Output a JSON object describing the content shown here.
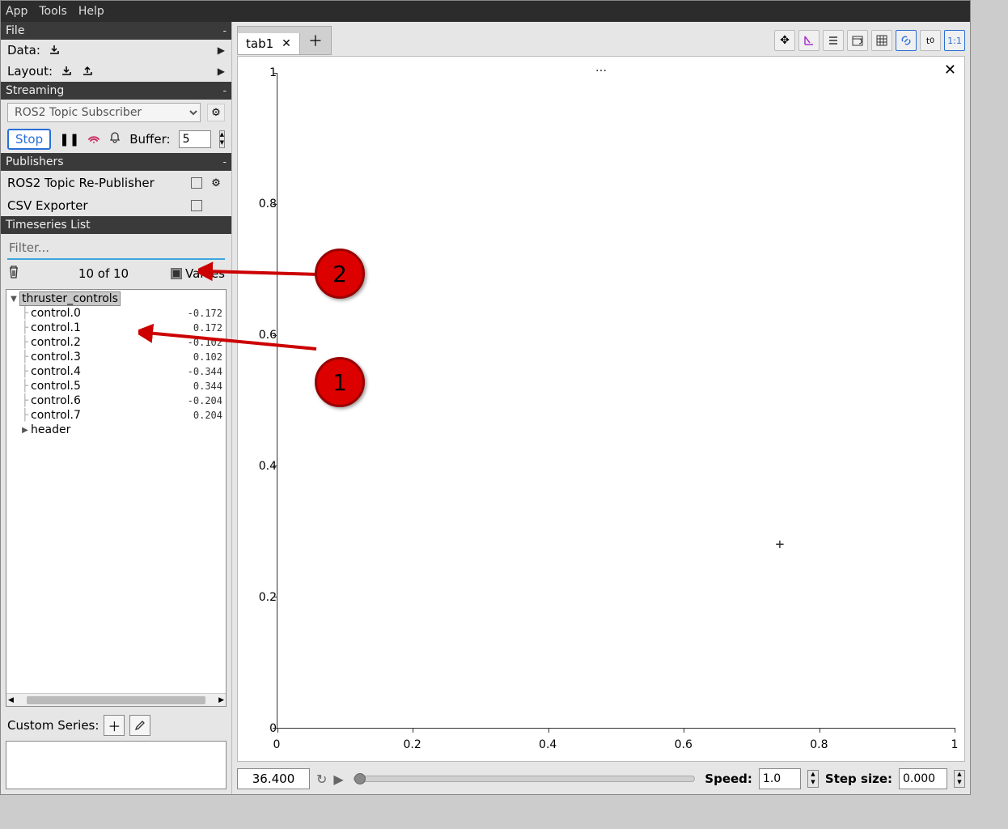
{
  "menu": {
    "app": "App",
    "tools": "Tools",
    "help": "Help"
  },
  "sections": {
    "file": "File",
    "data_label": "Data:",
    "layout_label": "Layout:",
    "streaming": "Streaming",
    "publishers": "Publishers",
    "timeseries": "Timeseries List",
    "custom_series": "Custom Series:"
  },
  "streaming": {
    "select_value": "ROS2 Topic Subscriber",
    "stop_label": "Stop",
    "buffer_label": "Buffer:",
    "buffer_value": "5"
  },
  "publishers": [
    {
      "name": "ROS2 Topic Re-Publisher",
      "gear": true
    },
    {
      "name": "CSV Exporter",
      "gear": false
    }
  ],
  "filter_placeholder": "Filter...",
  "list_count": "10 of 10",
  "values_label": "Values",
  "tree": {
    "root": "thruster_controls",
    "items": [
      {
        "name": "control.0",
        "value": "-0.172"
      },
      {
        "name": "control.1",
        "value": "0.172"
      },
      {
        "name": "control.2",
        "value": "-0.102"
      },
      {
        "name": "control.3",
        "value": "0.102"
      },
      {
        "name": "control.4",
        "value": "-0.344"
      },
      {
        "name": "control.5",
        "value": "0.344"
      },
      {
        "name": "control.6",
        "value": "-0.204"
      },
      {
        "name": "control.7",
        "value": "0.204"
      }
    ],
    "trailer": "header"
  },
  "tab": {
    "label": "tab1"
  },
  "chart_data": {
    "type": "line",
    "title": "...",
    "xlim": [
      0,
      1
    ],
    "ylim": [
      0,
      1
    ],
    "xticks": [
      0,
      0.2,
      0.4,
      0.6,
      0.8,
      1
    ],
    "yticks": [
      0,
      0.2,
      0.4,
      0.6,
      0.8,
      1
    ],
    "series": []
  },
  "playback": {
    "time": "36.400",
    "speed_label": "Speed:",
    "speed_value": "1.0",
    "step_label": "Step size:",
    "step_value": "0.000"
  },
  "annotations": {
    "a1": "1",
    "a2": "2"
  }
}
